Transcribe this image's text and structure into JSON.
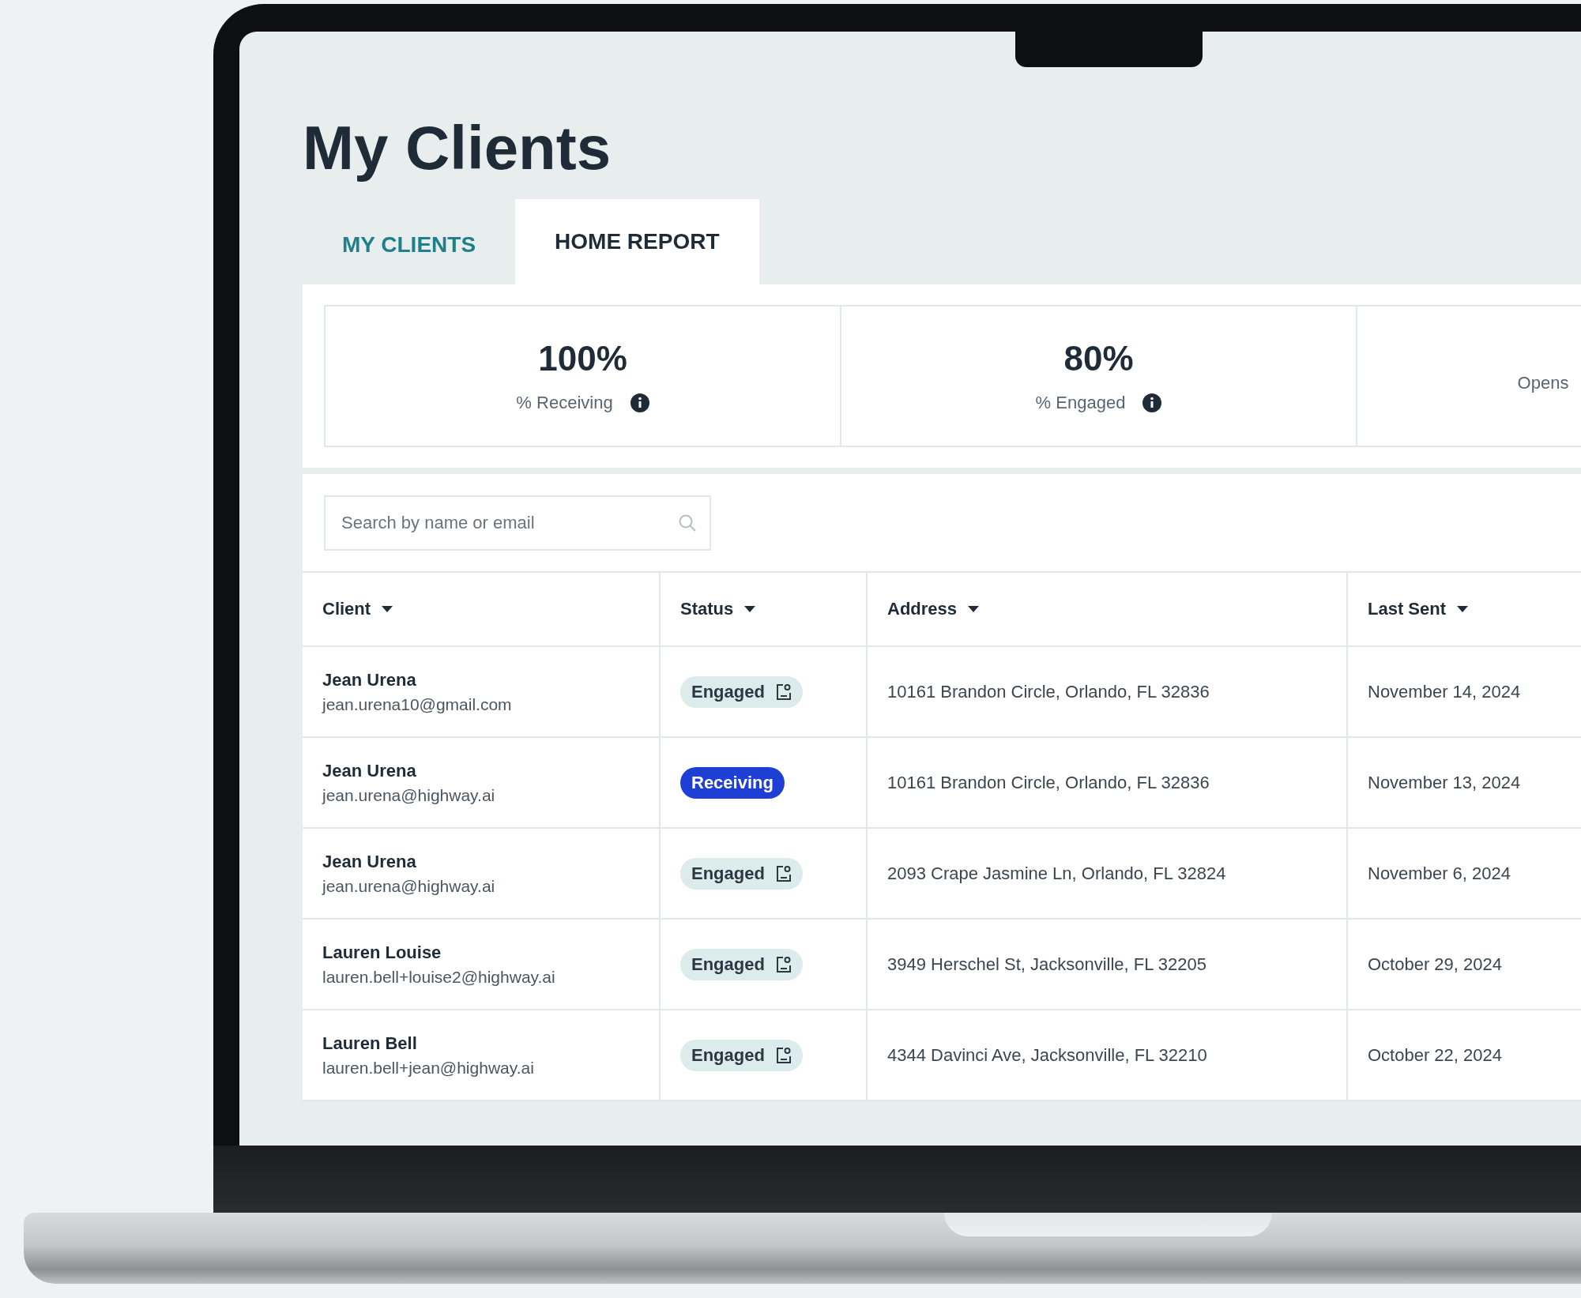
{
  "page": {
    "title": "My Clients"
  },
  "tabs": [
    {
      "label": "MY CLIENTS",
      "selected": false
    },
    {
      "label": "HOME REPORT",
      "selected": true
    }
  ],
  "stats": [
    {
      "value": "100%",
      "label": "% Receiving",
      "info": true
    },
    {
      "value": "80%",
      "label": "% Engaged",
      "info": true
    },
    {
      "label": "Opens",
      "info": false
    }
  ],
  "search": {
    "placeholder": "Search by name or email"
  },
  "table": {
    "columns": [
      "Client",
      "Status",
      "Address",
      "Last Sent"
    ],
    "rows": [
      {
        "name": "Jean Urena",
        "email": "jean.urena10@gmail.com",
        "status": {
          "label": "Engaged",
          "kind": "engaged"
        },
        "address": "10161 Brandon Circle, Orlando, FL 32836",
        "last_sent": "November 14, 2024"
      },
      {
        "name": "Jean Urena",
        "email": "jean.urena@highway.ai",
        "status": {
          "label": "Receiving",
          "kind": "receiving"
        },
        "address": "10161 Brandon Circle, Orlando, FL 32836",
        "last_sent": "November 13, 2024"
      },
      {
        "name": "Jean Urena",
        "email": "jean.urena@highway.ai",
        "status": {
          "label": "Engaged",
          "kind": "engaged"
        },
        "address": "2093 Crape Jasmine Ln, Orlando, FL 32824",
        "last_sent": "November 6, 2024"
      },
      {
        "name": "Lauren Louise",
        "email": "lauren.bell+louise2@highway.ai",
        "status": {
          "label": "Engaged",
          "kind": "engaged"
        },
        "address": "3949 Herschel St, Jacksonville, FL 32205",
        "last_sent": "October 29, 2024"
      },
      {
        "name": "Lauren Bell",
        "email": "lauren.bell+jean@highway.ai",
        "status": {
          "label": "Engaged",
          "kind": "engaged"
        },
        "address": "4344 Davinci Ave, Jacksonville, FL 32210",
        "last_sent": "October 22, 2024"
      }
    ]
  }
}
